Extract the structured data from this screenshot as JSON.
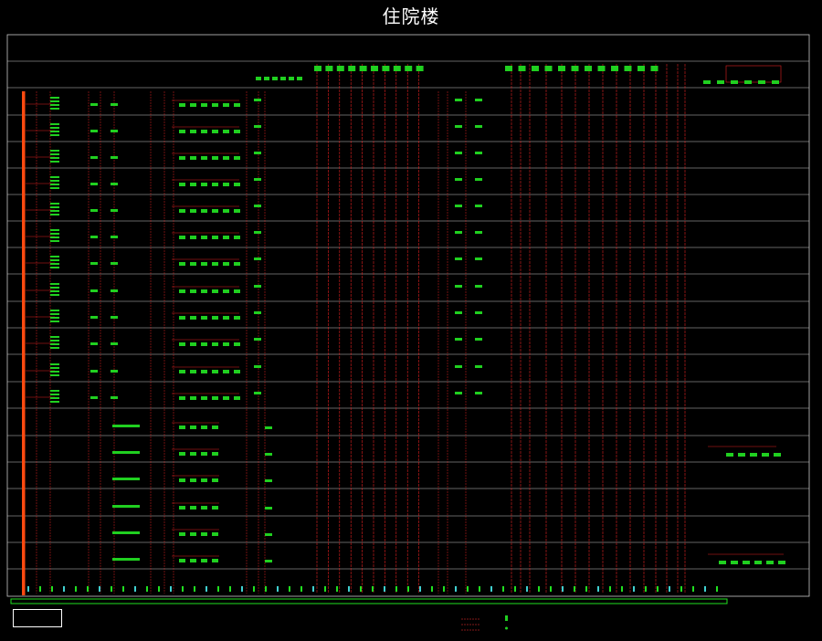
{
  "title": "住院楼",
  "colors": {
    "background": "#000000",
    "frame": "#c8c8c8",
    "riser": "#e02020",
    "panel": "#20d020",
    "label": "#ffff40",
    "bus": "#ff4a10",
    "ground": "#20e020",
    "terminal": "#40d0d0"
  },
  "legend_icons": [
    "panel-icon",
    "outlet-icon"
  ]
}
